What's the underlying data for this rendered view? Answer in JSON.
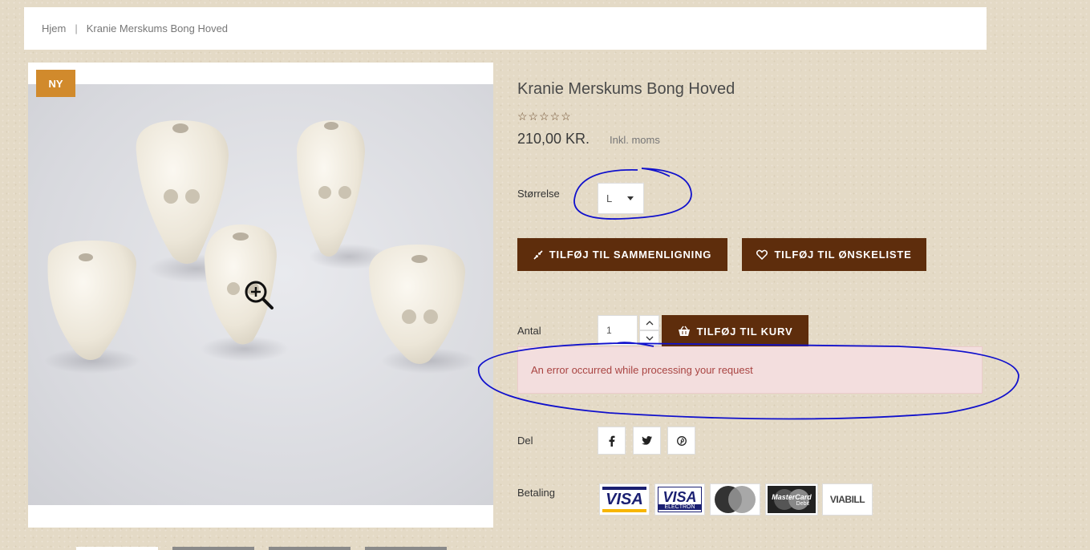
{
  "breadcrumb": {
    "home": "Hjem",
    "separator": "|",
    "current": "Kranie Merskums Bong Hoved"
  },
  "gallery": {
    "badge": "NY",
    "zoom_icon": "zoom-in-icon"
  },
  "product": {
    "title": "Kranie Merskums Bong Hoved",
    "rating_stars": "☆☆☆☆☆",
    "rating_value": 0,
    "price": "210,00 KR.",
    "price_note": "Inkl. moms"
  },
  "options": {
    "size_label": "Størrelse",
    "size_value": "L"
  },
  "actions": {
    "compare_label": "TILFØJ TIL SAMMENLIGNING",
    "wishlist_label": "TILFØJ TIL ØNSKELISTE",
    "cart_label": "TILFØJ TIL KURV"
  },
  "quantity": {
    "label": "Antal",
    "value": "1"
  },
  "error": {
    "message": "An error occurred while processing your request"
  },
  "share": {
    "label": "Del",
    "icons": [
      "facebook-icon",
      "twitter-icon",
      "pinterest-icon"
    ]
  },
  "payment": {
    "label": "Betaling",
    "methods": [
      "VISA",
      "VISA ELECTRON",
      "MasterCard Debit",
      "ViaBill"
    ],
    "visa": "VISA",
    "visa_electron_top": "VISA",
    "visa_electron_bottom": "ELECTRON",
    "mastercard_top": "MasterCard",
    "mastercard_bottom": "Debit",
    "viabill": "VIABILL"
  },
  "colors": {
    "brand_brown": "#5e2d0c",
    "badge_orange": "#d18a2c",
    "error_text": "#a94442",
    "annotation_blue": "#1010cc"
  }
}
